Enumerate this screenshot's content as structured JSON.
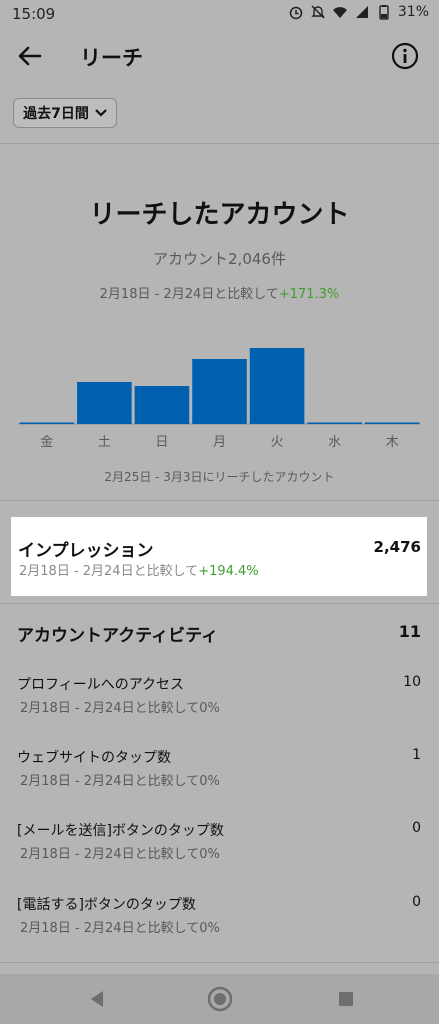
{
  "status_bar": {
    "time": "15:09",
    "battery": "31%"
  },
  "header": {
    "title": "リーチ"
  },
  "filter": {
    "label": "過去7日間"
  },
  "reach": {
    "title": "リーチしたアカウント",
    "accounts": "アカウント2,046件",
    "compare_prefix": "2月18日 - 2月24日と比較して",
    "compare_change": "+171.3%",
    "caption": "2月25日 - 3月3日にリーチしたアカウント"
  },
  "chart_data": {
    "type": "bar",
    "categories": [
      "金",
      "土",
      "日",
      "月",
      "火",
      "水",
      "木"
    ],
    "values": [
      1,
      42,
      38,
      65,
      76,
      1,
      1
    ],
    "ylim": [
      0,
      80
    ],
    "grid": false,
    "colors": {
      "bar": "#0060b0",
      "axis": "#8f8f8f"
    }
  },
  "impressions": {
    "label": "インプレッション",
    "value": "2,476",
    "compare_prefix": "2月18日 - 2月24日と比較して",
    "compare_change": "+194.4%"
  },
  "activity": {
    "title": "アカウントアクティビティ",
    "total": "11",
    "rows": [
      {
        "label": "プロフィールへのアクセス",
        "value": "10",
        "compare": "2月18日 - 2月24日と比較して0%"
      },
      {
        "label": "ウェブサイトのタップ数",
        "value": "1",
        "compare": "2月18日 - 2月24日と比較して0%"
      },
      {
        "label": "[メールを送信]ボタンのタップ数",
        "value": "0",
        "compare": "2月18日 - 2月24日と比較して0%"
      },
      {
        "label": "[電話する]ボタンのタップ数",
        "value": "0",
        "compare": "2月18日 - 2月24日と比較して0%"
      }
    ]
  },
  "colors": {
    "positive": "#3f9e2c",
    "bar": "#0060b0",
    "highlight": "#ffffff",
    "overlay": "#b5b5b5"
  }
}
